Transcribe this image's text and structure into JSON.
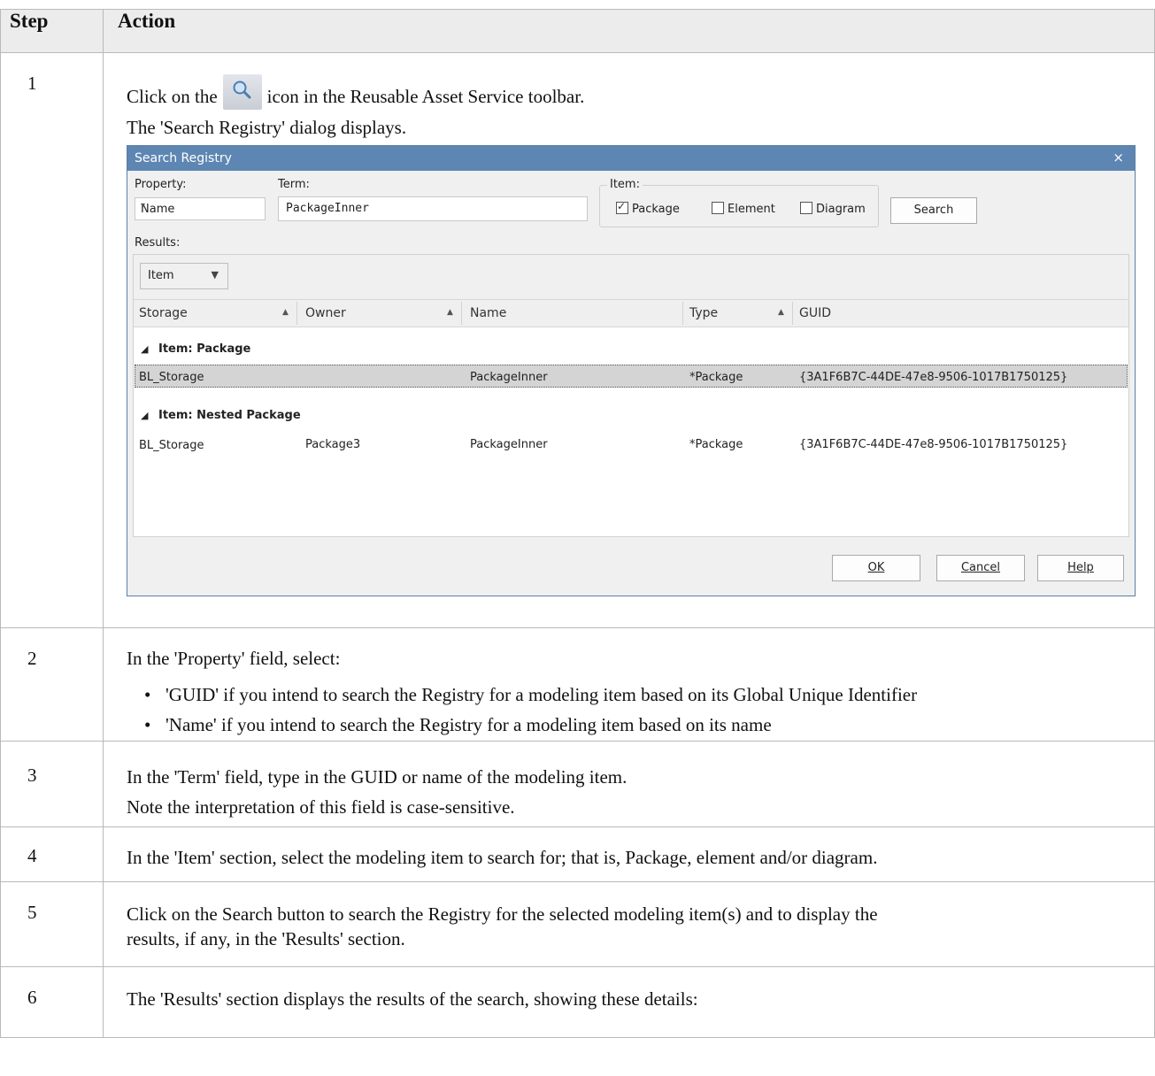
{
  "table": {
    "header": {
      "step": "Step",
      "action": "Action"
    },
    "rows": [
      {
        "step": "1",
        "line1_before": "Click on the",
        "line1_after": "icon in the Reusable Asset Service toolbar.",
        "line2": "The 'Search Registry' dialog displays."
      },
      {
        "step": "2",
        "intro": "In the 'Property' field, select:",
        "bullets": [
          "'GUID' if you intend to search the Registry for a modeling item based on its Global Unique Identifier",
          "'Name' if you intend to search the Registry for a modeling item based on its name"
        ]
      },
      {
        "step": "3",
        "line1": "In the 'Term' field, type in the GUID or name of the modeling item.",
        "line2": "Note the interpretation of this field is case-sensitive."
      },
      {
        "step": "4",
        "line1": "In the 'Item' section, select the modeling item to search for; that is, Package, element and/or diagram."
      },
      {
        "step": "5",
        "line1": "Click on the Search button to search the Registry for the selected modeling item(s) and to display the",
        "line2": "results, if any, in the 'Results' section."
      },
      {
        "step": "6",
        "line1": "The 'Results' section displays the results of the search, showing these details:"
      }
    ]
  },
  "dialog": {
    "title": "Search Registry",
    "close": "×",
    "property_label": "Property:",
    "property_value": "Name",
    "term_label": "Term:",
    "term_value": "PackageInner",
    "item_label": "Item:",
    "chk_package": "Package",
    "chk_element": "Element",
    "chk_diagram": "Diagram",
    "search_btn": "Search",
    "results_label": "Results:",
    "groupby_value": "Item",
    "columns": [
      "Storage",
      "Owner",
      "Name",
      "Type",
      "GUID"
    ],
    "groups": [
      {
        "label": "Item: Package",
        "rows": [
          {
            "storage": "BL_Storage",
            "owner": "",
            "name": "PackageInner",
            "type": "*Package",
            "guid": "{3A1F6B7C-44DE-47e8-9506-1017B1750125}"
          }
        ]
      },
      {
        "label": "Item: Nested Package",
        "rows": [
          {
            "storage": "BL_Storage",
            "owner": "Package3",
            "name": "PackageInner",
            "type": "*Package",
            "guid": "{3A1F6B7C-44DE-47e8-9506-1017B1750125}"
          }
        ]
      }
    ],
    "ok": "OK",
    "cancel": "Cancel",
    "help": "Help"
  },
  "colors": {
    "titlebar": "#5e86b2",
    "header_bg": "#ececec",
    "selected_row": "#d4d4d4"
  },
  "icons": {
    "toolbar_icon": "magnifier-icon"
  }
}
